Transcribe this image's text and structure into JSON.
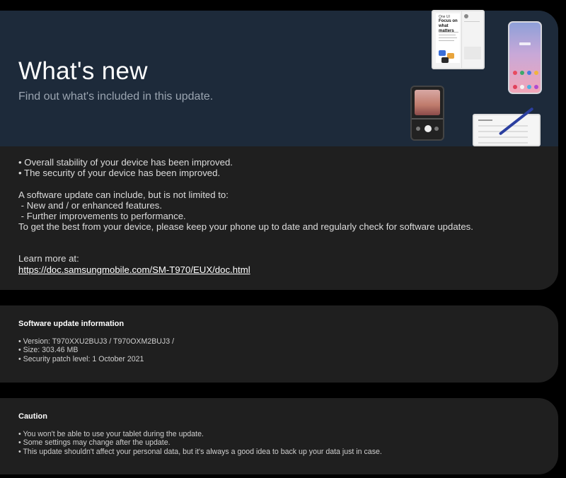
{
  "whats_new": {
    "title": "What's new",
    "subtitle": "Find out what's included in this update.",
    "lines": [
      "• Overall stability of your device has been improved.",
      "• The security of your device has been improved.",
      "A software update can include, but is not limited to:",
      " - New and / or enhanced features.",
      " - Further improvements to performance.",
      "To get the best from your device, please keep your phone up to date and regularly check for software updates."
    ],
    "learn_more_label": "Learn more at:",
    "learn_more_url": "https://doc.samsungmobile.com/SM-T970/EUX/doc.html",
    "illustration_text": {
      "brand": "One UI",
      "headline_line1": "Focus on",
      "headline_line2": "what matters"
    }
  },
  "software_info": {
    "title": "Software update information",
    "lines": [
      "• Version: T970XXU2BUJ3 / T970OXM2BUJ3 /",
      "• Size: 303.46 MB",
      "• Security patch level: 1 October 2021"
    ]
  },
  "caution": {
    "title": "Caution",
    "lines": [
      "• You won't be able to use your tablet during the update.",
      "• Some settings may change after the update.",
      "• This update shouldn't affect your personal data, but it's always a good idea to back up your data just in case."
    ]
  },
  "colors": {
    "background": "#000000",
    "card": "#1f1f1f",
    "hero": "#1d2a3a",
    "subtitle": "#9aa4b0"
  },
  "icons": [
    "tablet-illustration-icon",
    "phone-illustration-icon",
    "flip-phone-illustration-icon",
    "tablet-pen-illustration-icon"
  ]
}
